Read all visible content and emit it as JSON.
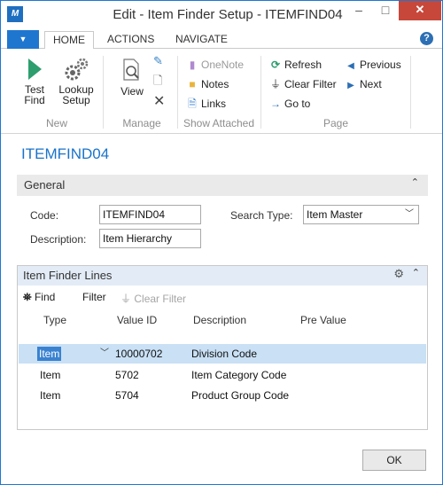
{
  "window": {
    "title": "Edit - Item Finder Setup - ITEMFIND04",
    "minimize_glyph": "–",
    "maximize_glyph": "□",
    "close_glyph": "✕"
  },
  "tabs": {
    "home": "HOME",
    "actions": "ACTIONS",
    "navigate": "NAVIGATE",
    "help_glyph": "?"
  },
  "ribbon": {
    "new": {
      "group_label": "New",
      "test_find_line1": "Test",
      "test_find_line2": "Find",
      "lookup_setup_line1": "Lookup",
      "lookup_setup_line2": "Setup"
    },
    "manage": {
      "group_label": "Manage",
      "view": "View"
    },
    "show_attached": {
      "group_label": "Show Attached",
      "onenote": "OneNote",
      "notes": "Notes",
      "links": "Links"
    },
    "page": {
      "group_label": "Page",
      "refresh": "Refresh",
      "clear_filter": "Clear Filter",
      "go_to": "Go to",
      "previous": "Previous",
      "next": "Next"
    }
  },
  "page_caption": "ITEMFIND04",
  "general": {
    "title": "General",
    "code_label": "Code:",
    "code_value": "ITEMFIND04",
    "description_label": "Description:",
    "description_value": "Item Hierarchy",
    "search_type_label": "Search Type:",
    "search_type_value": "Item Master"
  },
  "lines": {
    "title": "Item Finder Lines",
    "toolbar": {
      "find": "Find",
      "filter": "Filter",
      "clear_filter": "Clear Filter"
    },
    "columns": {
      "type": "Type",
      "value_id": "Value ID",
      "description": "Description",
      "pre_value": "Pre Value"
    },
    "rows": [
      {
        "type": "Item",
        "value_id": "10000702",
        "description": "Division Code",
        "pre_value": ""
      },
      {
        "type": "Item",
        "value_id": "5702",
        "description": "Item Category Code",
        "pre_value": ""
      },
      {
        "type": "Item",
        "value_id": "5704",
        "description": "Product Group Code",
        "pre_value": ""
      }
    ]
  },
  "ok_button": "OK",
  "colors": {
    "accent": "#1a73c9",
    "selected_row": "#c9e0f5",
    "close_button": "#c7473a"
  }
}
